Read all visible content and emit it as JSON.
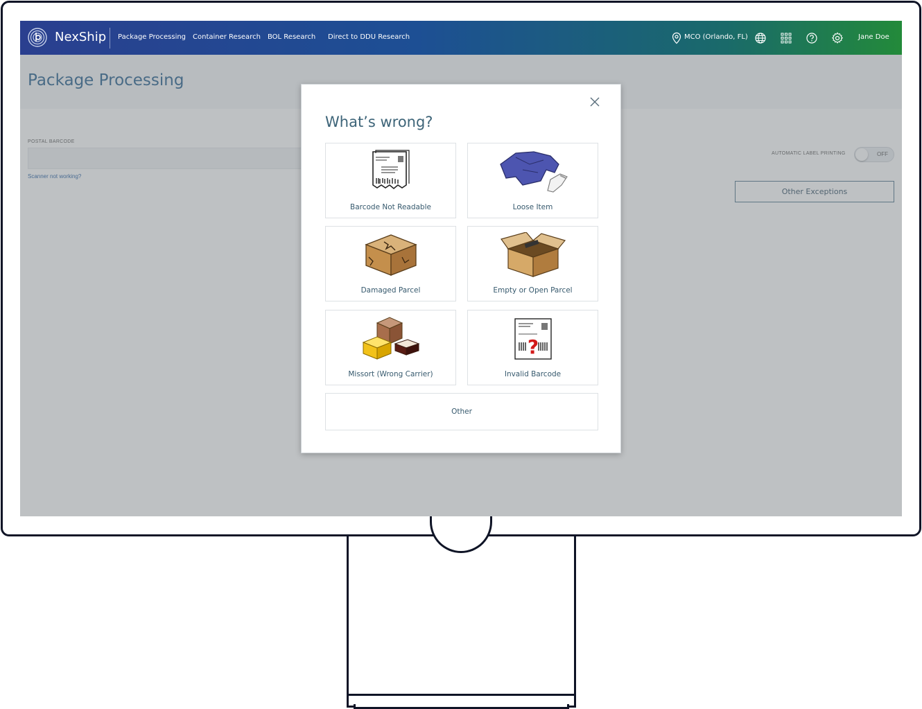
{
  "app": {
    "brand": "NexShip"
  },
  "nav": {
    "items": [
      "Package Processing",
      "Container Research",
      "BOL Research",
      "Direct to DDU Research"
    ]
  },
  "topbar": {
    "location": "MCO (Orlando, FL)",
    "user": "Jane Doe",
    "icons": [
      "location-pin-icon",
      "globe-icon",
      "apps-grid-icon",
      "help-icon",
      "settings-gear-icon"
    ]
  },
  "page": {
    "title": "Package Processing",
    "postal_barcode_label": "POSTAL BARCODE",
    "postal_barcode_value": "",
    "scanner_link": "Scanner not working?",
    "auto_label_printing_label": "AUTOMATIC LABEL PRINTING",
    "auto_label_printing_state": "OFF",
    "other_exceptions_label": "Other Exceptions"
  },
  "modal": {
    "title": "What’s wrong?",
    "options": [
      {
        "label": "Barcode Not Readable",
        "icon": "torn-label-icon"
      },
      {
        "label": "Loose Item",
        "icon": "loose-clothing-icon"
      },
      {
        "label": "Damaged Parcel",
        "icon": "damaged-box-icon"
      },
      {
        "label": "Empty or Open Parcel",
        "icon": "open-box-icon"
      },
      {
        "label": "Missort (Wrong Carrier)",
        "icon": "mixed-boxes-icon"
      },
      {
        "label": "Invalid Barcode",
        "icon": "question-barcode-icon"
      }
    ],
    "other_label": "Other"
  },
  "colors": {
    "topbar_start": "#2a3f8f",
    "topbar_end": "#238a3a",
    "title_blue": "#1f5a8a",
    "label_teal": "#36596d"
  }
}
